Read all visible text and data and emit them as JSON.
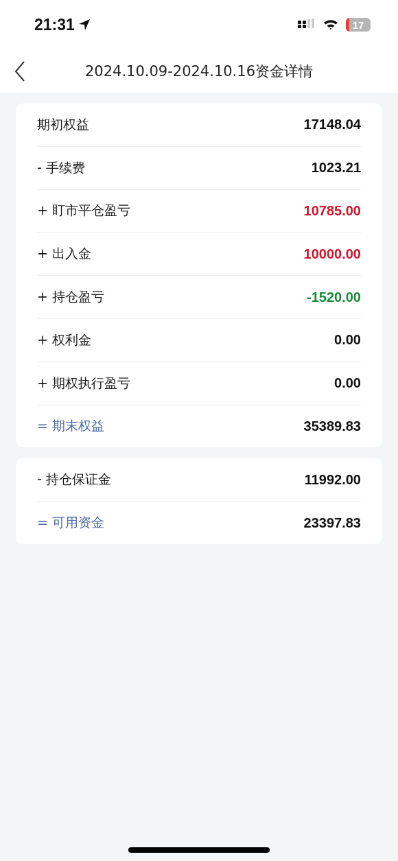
{
  "status_bar": {
    "time": "21:31",
    "battery": "17"
  },
  "header": {
    "title": "2024.10.09-2024.10.16资金详情"
  },
  "sections": [
    {
      "rows": [
        {
          "label": "期初权益",
          "value": "17148.04",
          "kind": "line",
          "color": "#111111"
        },
        {
          "label": "- 手续费",
          "value": "1023.21",
          "kind": "line",
          "color": "#111111"
        },
        {
          "label": "+ 盯市平仓盈亏",
          "value": "10785.00",
          "kind": "line",
          "color": "#d0142c"
        },
        {
          "label": "+ 出入金",
          "value": "10000.00",
          "kind": "line",
          "color": "#d0142c"
        },
        {
          "label": "+ 持仓盈亏",
          "value": "-1520.00",
          "kind": "line",
          "color": "#198a3c"
        },
        {
          "label": "+ 权利金",
          "value": "0.00",
          "kind": "line",
          "color": "#111111"
        },
        {
          "label": "+ 期权执行盈亏",
          "value": "0.00",
          "kind": "line",
          "color": "#111111"
        },
        {
          "label": "= 期末权益",
          "value": "35389.83",
          "kind": "total",
          "color": "#111111"
        }
      ]
    },
    {
      "rows": [
        {
          "label": "- 持仓保证金",
          "value": "11992.00",
          "kind": "line",
          "color": "#111111"
        },
        {
          "label": "= 可用资金",
          "value": "23397.83",
          "kind": "total",
          "color": "#111111"
        }
      ]
    }
  ]
}
